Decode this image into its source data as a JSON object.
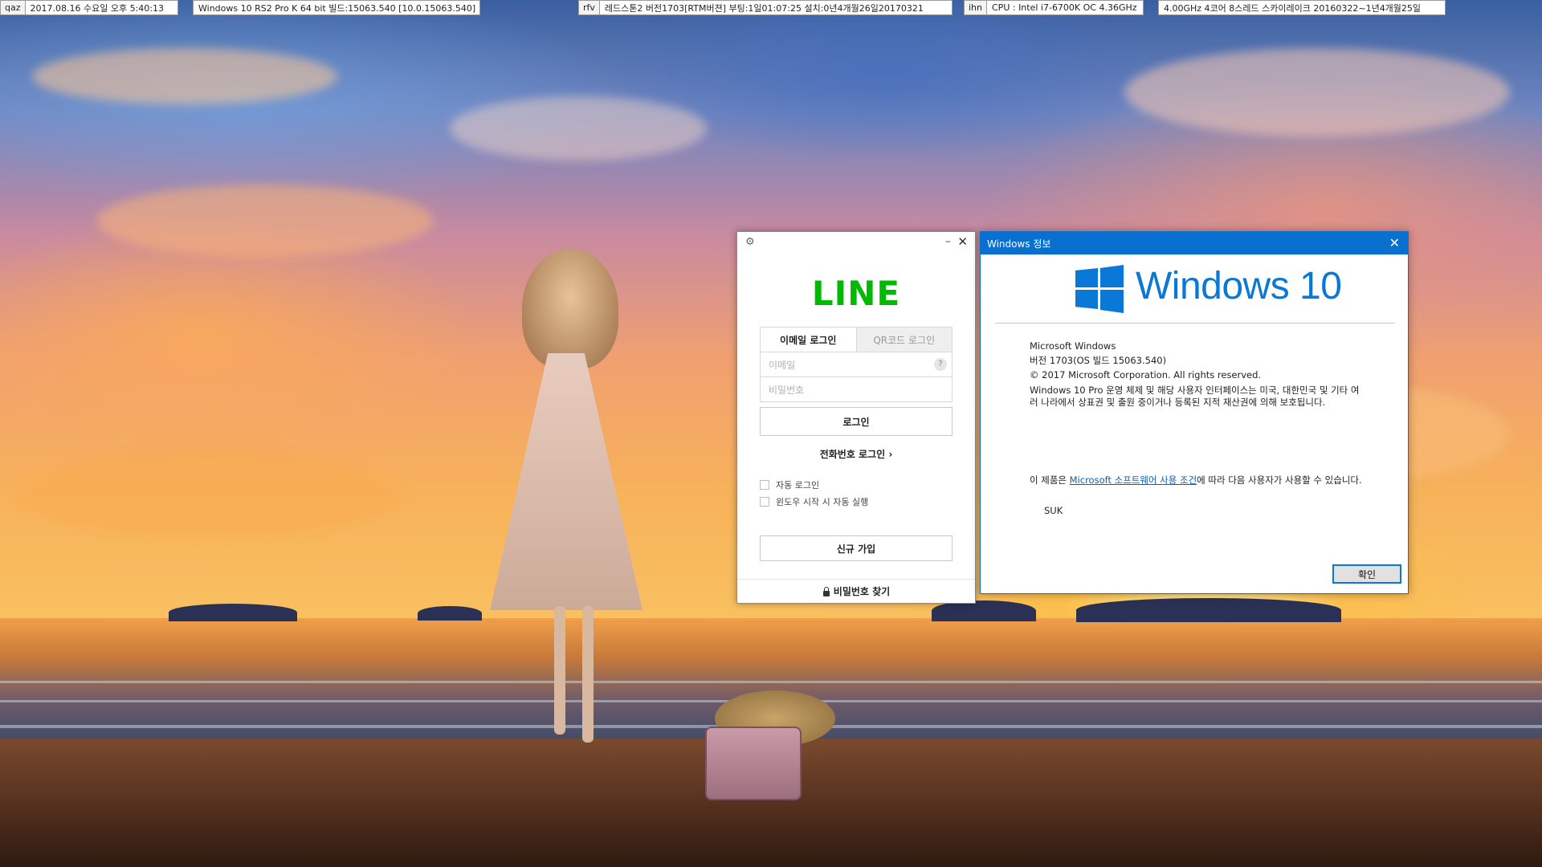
{
  "topbar": {
    "box1": {
      "tag": "qaz",
      "value": "2017.08.16 수요일  오후 5:40:13"
    },
    "box2": {
      "value": "Windows 10 RS2 Pro K 64 bit 빌드:15063.540 [10.0.15063.540]"
    },
    "box3": {
      "tag": "rfv",
      "value": "레드스톤2 버전1703[RTM버젼] 부팅:1일01:07:25 설치:0년4개월26일20170321"
    },
    "box4": {
      "tag": "ihn",
      "value": "CPU : Intel i7-6700K OC 4.36GHz"
    },
    "box5": {
      "value": "4.00GHz 4코어 8스레드 스카이레이크 20160322~1년4개월25일"
    }
  },
  "line_app": {
    "logo": "LINE",
    "tabs": [
      {
        "label": "이메일 로그인",
        "active": true
      },
      {
        "label": "QR코드 로그인",
        "active": false
      }
    ],
    "email_placeholder": "이메일",
    "password_placeholder": "비밀번호",
    "help_symbol": "?",
    "login_button": "로그인",
    "phone_login": "전화번호 로그인 ›",
    "options": [
      "자동 로그인",
      "윈도우 시작 시 자동 실행"
    ],
    "signup_button": "신규 가입",
    "find_password": "비밀번호 찾기",
    "brand_color": "#00B900"
  },
  "winver": {
    "title": "Windows 정보",
    "wordmark": "Windows 10",
    "product": "Microsoft Windows",
    "version": "버전 1703(OS 빌드 15063.540)",
    "copyright": "© 2017 Microsoft Corporation. All rights reserved.",
    "trademark": "Windows 10 Pro 운영 체제 및 해당 사용자 인터페이스는 미국, 대한민국 및 기타 여러 나라에서 상표권 및 출원 중이거나 등록된 지적 재산권에 의해 보호됩니다.",
    "license_prefix": "이 제품은 ",
    "license_link": "Microsoft 소프트웨어 사용 조건",
    "license_suffix": "에 따라 다음 사용자가 사용할 수 있습니다.",
    "user": "SUK",
    "ok_button": "확인",
    "accent_color": "#0A78D7"
  }
}
